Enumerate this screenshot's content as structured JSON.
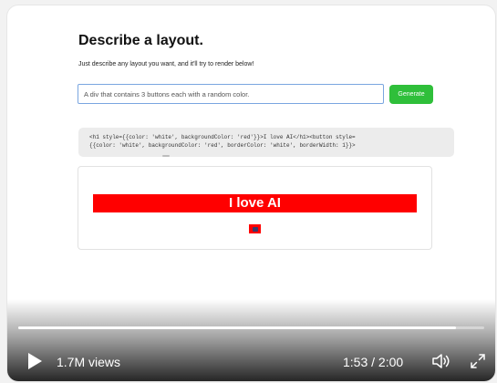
{
  "app": {
    "title": "Describe a layout.",
    "subtitle": "Just describe any layout you want, and it'll try to render below!"
  },
  "prompt": {
    "value": "A div that contains 3 buttons each with a random color.",
    "button_label": "Generate"
  },
  "code": {
    "line1": "<h1 style={{color: 'white', backgroundColor: 'red'}}>I love AI</h1><button style=",
    "line2": "{{color: 'white', backgroundColor: 'red', borderColor: 'white', borderWidth: 1}}>"
  },
  "preview": {
    "heading": "I love AI",
    "heading_bg": "#ff0000",
    "button_color": "#ff0000"
  },
  "player": {
    "views": "1.7M views",
    "time": "1:53 / 2:00",
    "progress": 0.94,
    "icons": [
      "play-icon",
      "volume-icon",
      "fullscreen-icon"
    ]
  }
}
